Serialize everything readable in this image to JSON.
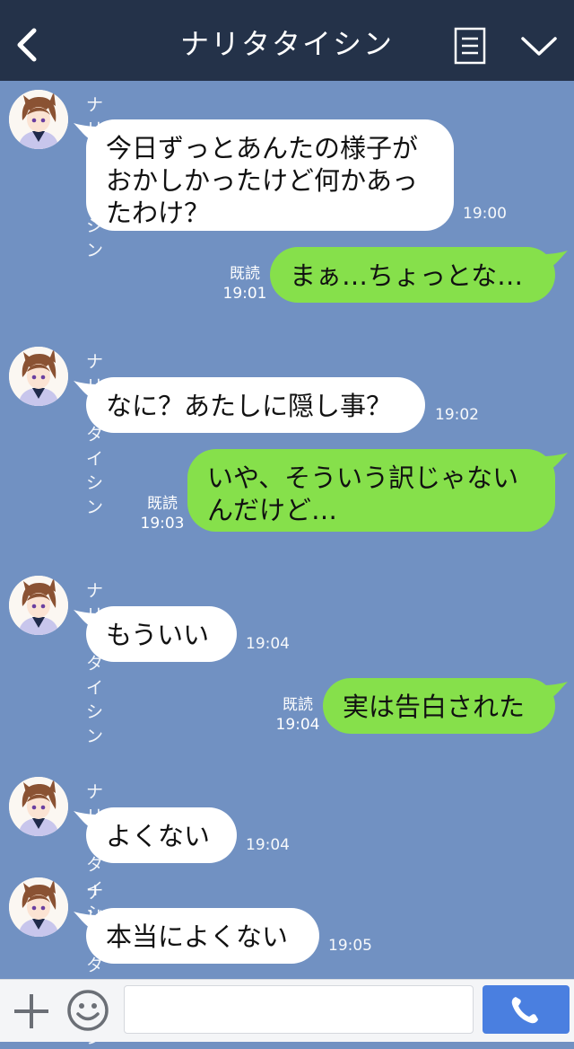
{
  "header": {
    "title": "ナリタタイシン",
    "icons": [
      "back-chevron-icon",
      "notes-menu-icon",
      "chevron-down-icon"
    ]
  },
  "messages": [
    {
      "side": "in",
      "sender": "ナリタタイシン",
      "text": "今日ずっとあんたの様子が\nおかしかったけど何かあっ\nたわけ？",
      "time": "19:00"
    },
    {
      "side": "out",
      "read": "既読",
      "text": "まぁ…ちょっとな…",
      "time": "19:01"
    },
    {
      "side": "in",
      "sender": "ナリタタイシン",
      "text": "なに？あたしに隠し事？",
      "time": "19:02"
    },
    {
      "side": "out",
      "read": "既読",
      "text": "いや、そういう訳じゃない\nんだけど…",
      "time": "19:03"
    },
    {
      "side": "in",
      "sender": "ナリタタイシン",
      "text": "もういい",
      "time": "19:04"
    },
    {
      "side": "out",
      "read": "既読",
      "text": "実は告白された",
      "time": "19:04"
    },
    {
      "side": "in",
      "sender": "ナリタタイシン",
      "text": "よくない",
      "time": "19:04"
    },
    {
      "side": "in",
      "sender": "ナリタタイシン",
      "text": "本当によくない",
      "time": "19:05"
    }
  ],
  "footer": {
    "input_value": "",
    "icons": [
      "plus-icon",
      "smile-icon",
      "phone-icon"
    ]
  },
  "colors": {
    "header_bg": "#243249",
    "chat_bg": "#7191c2",
    "outgoing_bubble": "#86e04b",
    "incoming_bubble": "#ffffff",
    "send_button": "#4a7fe0"
  }
}
